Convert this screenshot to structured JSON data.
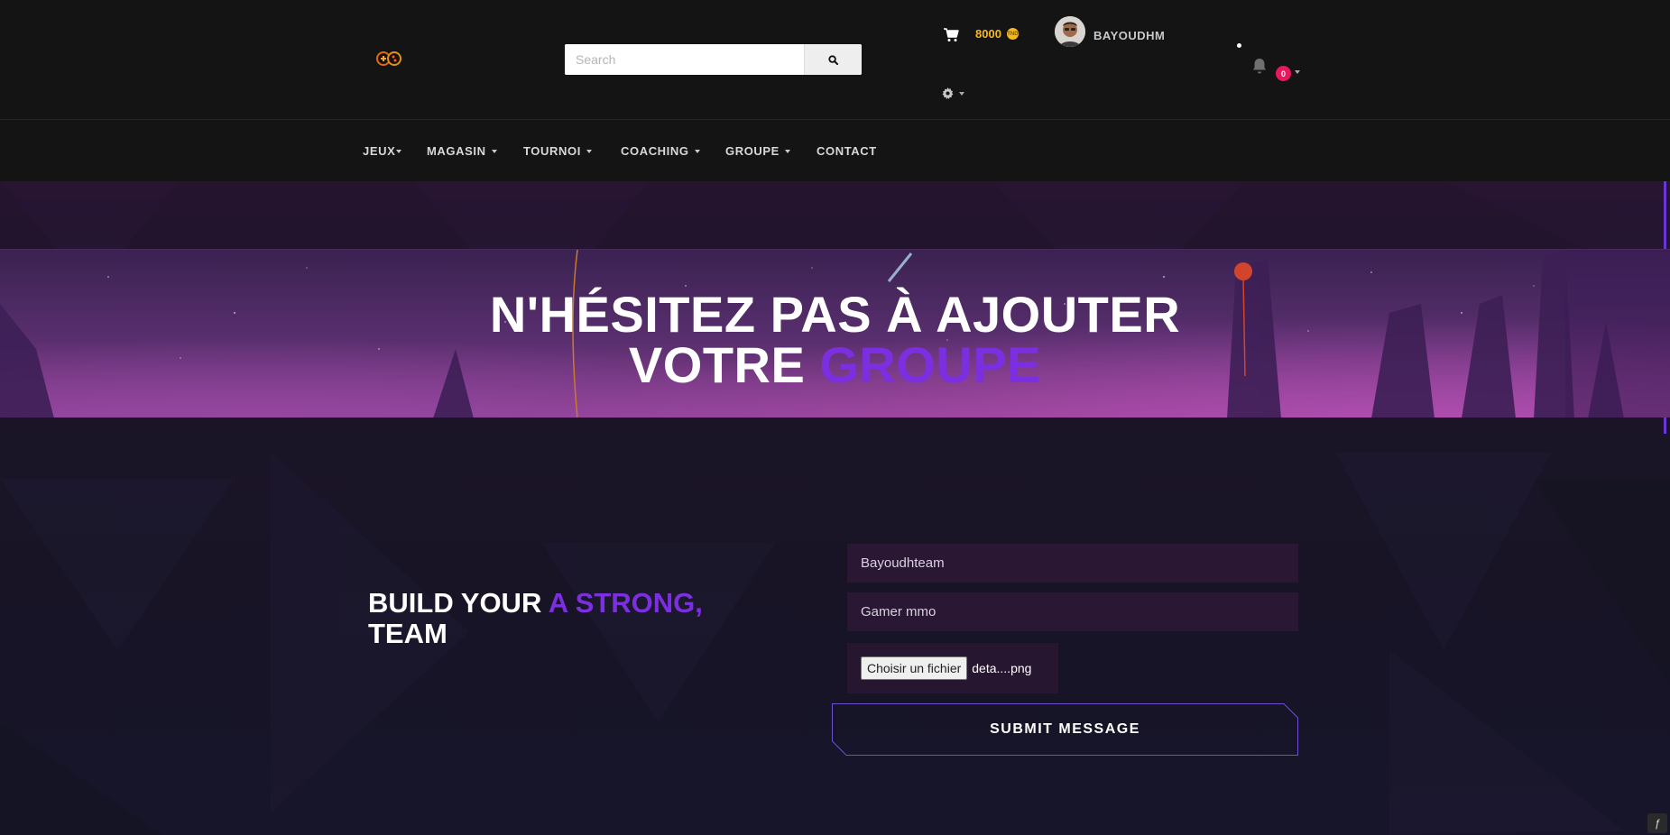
{
  "header": {
    "search_placeholder": "Search",
    "coins": "8000",
    "coin_symbol": "TND",
    "username": "BAYOUDHM",
    "notifications_count": "0"
  },
  "nav": {
    "items": [
      {
        "label": "JEUX",
        "has_dropdown": true
      },
      {
        "label": "MAGASIN",
        "has_dropdown": true
      },
      {
        "label": "TOURNOI",
        "has_dropdown": true
      },
      {
        "label": "COACHING",
        "has_dropdown": true
      },
      {
        "label": "GROUPE",
        "has_dropdown": true
      },
      {
        "label": "CONTACT",
        "has_dropdown": false
      }
    ]
  },
  "banner": {
    "line1": "N'HÉSITEZ PAS À AJOUTER",
    "line2_prefix": "VOTRE ",
    "line2_accent": "GROUPE"
  },
  "form": {
    "heading_part1": "BUILD YOUR ",
    "heading_accent": "A STRONG,",
    "heading_part2": "TEAM",
    "group_name_value": "Bayoudhteam",
    "group_type_value": "Gamer mmo",
    "file_button_label": "Choisir un fichier",
    "file_name": "deta....png",
    "submit_label": "SUBMIT MESSAGE"
  },
  "colors": {
    "accent": "#7b2fe0",
    "coins": "#f6b91d",
    "badge": "#e6195e",
    "header_bg": "#141414",
    "field_bg": "#2a1733"
  },
  "icons": [
    "logo-icon",
    "search-icon",
    "cart-icon",
    "coin-icon",
    "avatar",
    "bell-icon",
    "gear-icon",
    "symfony-icon"
  ]
}
